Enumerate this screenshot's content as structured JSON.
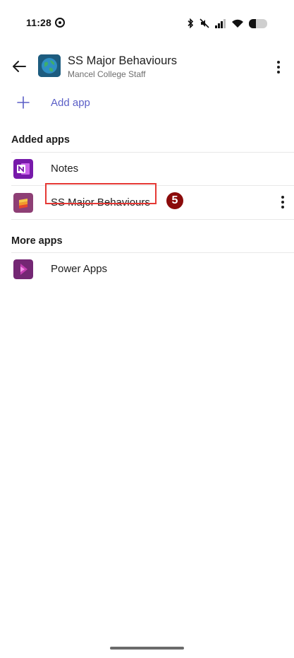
{
  "status_bar": {
    "time": "11:28"
  },
  "header": {
    "title": "SS Major Behaviours",
    "subtitle": "Mancel College Staff"
  },
  "add_app": {
    "label": "Add app"
  },
  "sections": {
    "added_apps": "Added apps",
    "more_apps": "More apps"
  },
  "added_apps": [
    {
      "label": "Notes",
      "icon": "onenote-icon"
    },
    {
      "label": "SS Major Behaviours",
      "icon": "lists-app-icon"
    }
  ],
  "more_apps": [
    {
      "label": "Power Apps",
      "icon": "power-apps-icon"
    }
  ],
  "annotation": {
    "step": "5"
  },
  "colors": {
    "accent": "#5b5fc7",
    "highlight": "#e53935",
    "badge": "#8b0b0b"
  }
}
